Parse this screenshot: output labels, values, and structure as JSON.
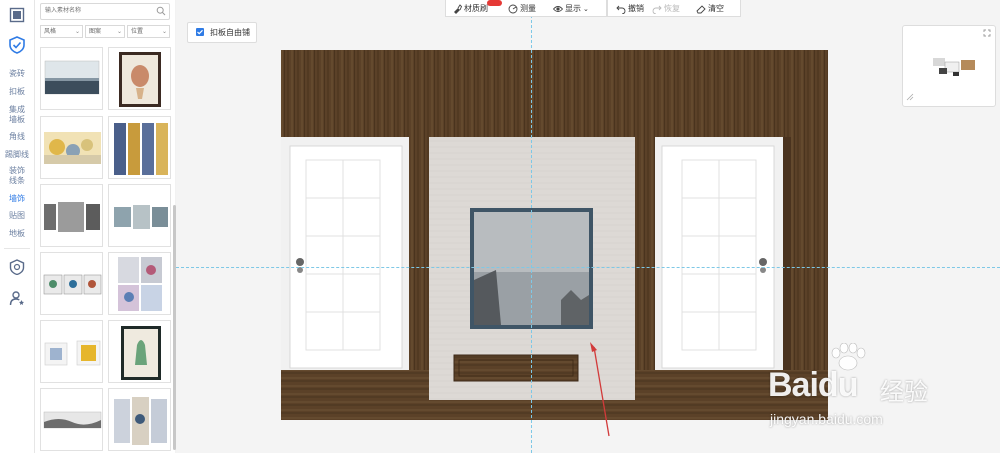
{
  "sidebar": {
    "items": [
      {
        "label": "瓷砖"
      },
      {
        "label": "扣板"
      },
      {
        "label": "集成墙板"
      },
      {
        "label": "角线"
      },
      {
        "label": "踢脚线"
      },
      {
        "label": "装饰线条"
      },
      {
        "label": "墙饰"
      },
      {
        "label": "贴图"
      },
      {
        "label": "地板"
      }
    ],
    "active_index": 6,
    "active_color": "#2f7be5"
  },
  "library": {
    "search_placeholder": "输入素材名称",
    "filters": [
      {
        "label": "风格"
      },
      {
        "label": "图案"
      },
      {
        "label": "位置"
      }
    ],
    "thumbnails": [
      {
        "name": "landscape-painting"
      },
      {
        "name": "flower-vase-framed"
      },
      {
        "name": "gold-abstract"
      },
      {
        "name": "triptych-blue-gold"
      },
      {
        "name": "bw-triptych"
      },
      {
        "name": "elephant-panels"
      },
      {
        "name": "birds-triptych"
      },
      {
        "name": "four-panel-floral"
      },
      {
        "name": "blue-gold-pair"
      },
      {
        "name": "vase-framed"
      },
      {
        "name": "ink-landscape"
      },
      {
        "name": "floral-triptych"
      }
    ]
  },
  "toolbar": {
    "material_brush": "材质刷",
    "measure": "测量",
    "display": "显示",
    "undo": "撤销",
    "redo": "恢复",
    "clear": "清空"
  },
  "canvas": {
    "free_pave_label": "扣板自由铺",
    "free_pave_checked": true
  },
  "watermark": {
    "brand": "Bai",
    "brand2": "du",
    "cn": "经验",
    "url": "jingyan.baidu.com"
  }
}
